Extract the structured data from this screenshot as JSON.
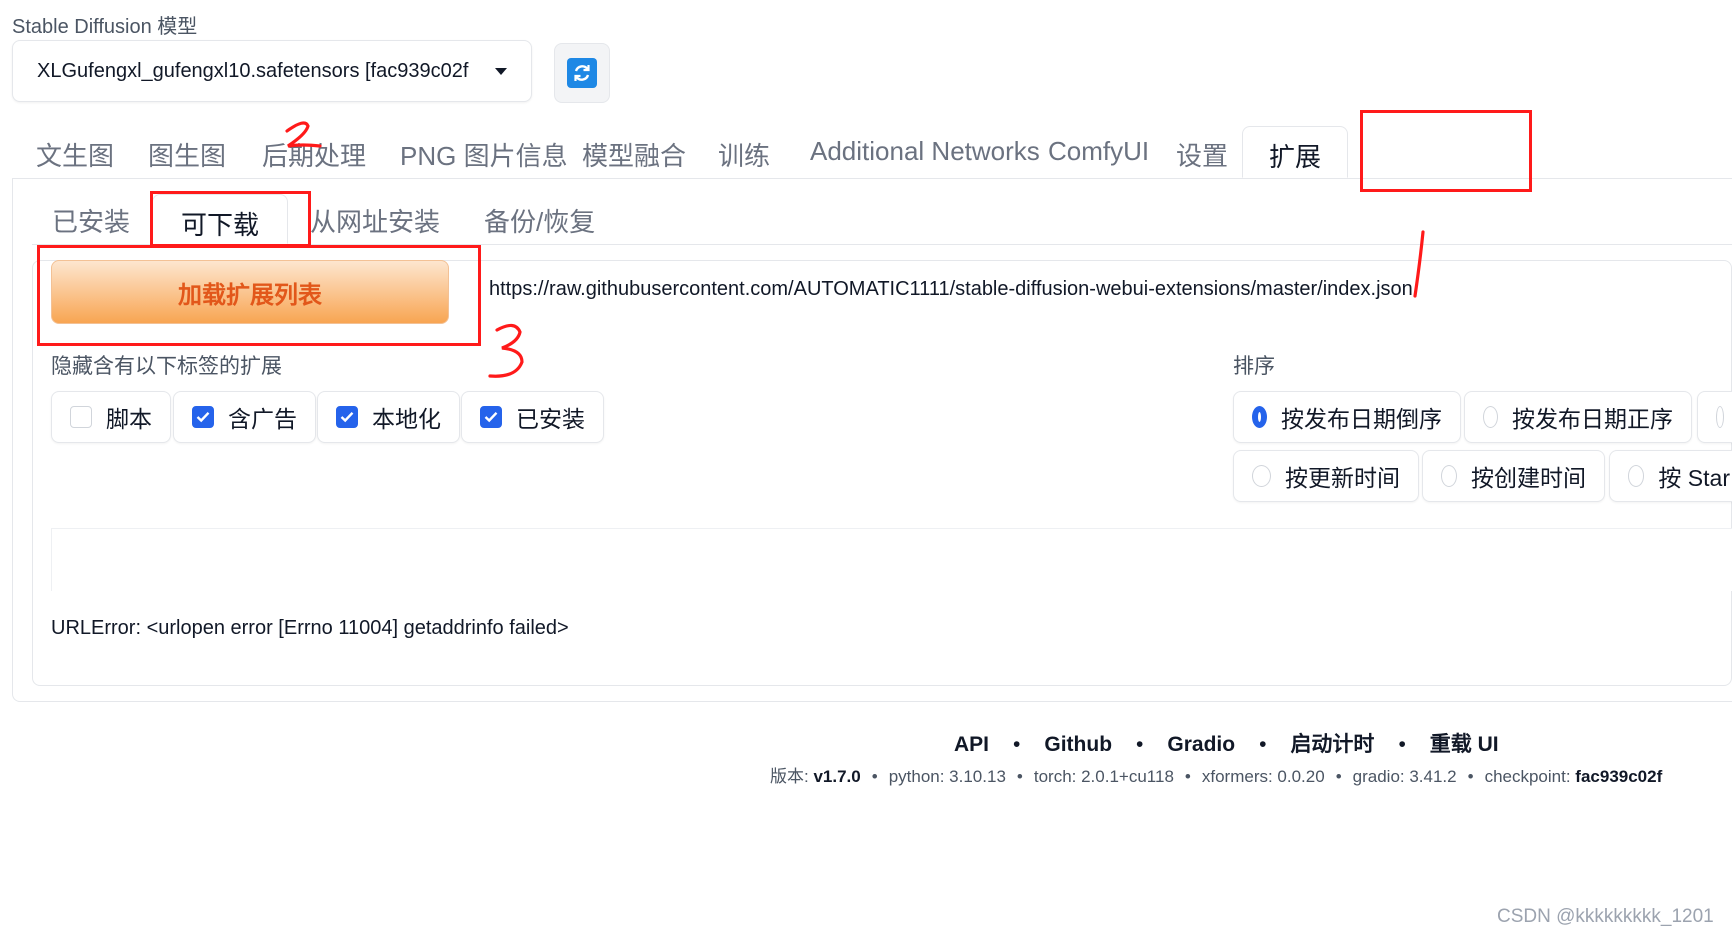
{
  "model": {
    "label": "Stable Diffusion 模型",
    "selected": "XLGufengxl_gufengxl10.safetensors [fac939c02f"
  },
  "main_tabs": [
    "文生图",
    "图生图",
    "后期处理",
    "PNG 图片信息",
    "模型融合",
    "训练",
    "Additional Networks",
    "ComfyUI",
    "设置",
    "扩展"
  ],
  "sub_tabs": [
    "已安装",
    "可下载",
    "从网址安装",
    "备份/恢复"
  ],
  "load_button": "加载扩展列表",
  "index_url": "https://raw.githubusercontent.com/AUTOMATIC1111/stable-diffusion-webui-extensions/master/index.json",
  "hide_tags": {
    "label": "隐藏含有以下标签的扩展",
    "options": [
      {
        "label": "脚本",
        "checked": false
      },
      {
        "label": "含广告",
        "checked": true
      },
      {
        "label": "本地化",
        "checked": true
      },
      {
        "label": "已安装",
        "checked": true
      }
    ]
  },
  "sort": {
    "label": "排序",
    "options": [
      {
        "label": "按发布日期倒序",
        "selected": true
      },
      {
        "label": "按发布日期正序",
        "selected": false
      },
      {
        "label": "按更新时间",
        "selected": false
      },
      {
        "label": "按创建时间",
        "selected": false
      },
      {
        "label": "按 Star",
        "selected": false
      }
    ]
  },
  "error": "URLError: <urlopen error [Errno 11004] getaddrinfo failed>",
  "footer": {
    "links": [
      "API",
      "Github",
      "Gradio",
      "启动计时",
      "重载 UI"
    ],
    "versions": {
      "version_label": "版本:",
      "version": "v1.7.0",
      "python": "python: 3.10.13",
      "torch": "torch: 2.0.1+cu118",
      "xformers": "xformers: 0.0.20",
      "gradio": "gradio: 3.41.2",
      "checkpoint_label": "checkpoint:",
      "checkpoint": "fac939c02f"
    }
  },
  "annotations": {
    "mark_2": "2",
    "mark_1": "1",
    "mark_3": "3",
    "color": "#ff1a1a"
  },
  "watermark": "CSDN @kkkkkkkkk_1201",
  "colors": {
    "accent": "#2563eb",
    "button_text": "#e2571a",
    "button_bg": "#f8a552"
  }
}
